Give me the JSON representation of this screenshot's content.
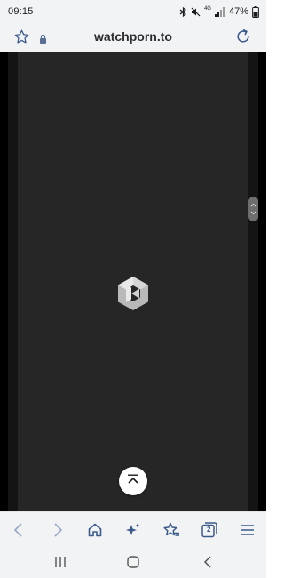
{
  "status_bar": {
    "time": "09:15",
    "network_label": "4G",
    "battery": "47%",
    "icons": [
      "bluetooth-icon",
      "mute-icon",
      "signal-icon",
      "battery-icon"
    ]
  },
  "address_bar": {
    "url": "watchporn.to",
    "icons": [
      "star-icon",
      "lock-icon",
      "reload-icon"
    ]
  },
  "toolbar": {
    "tab_count": "2",
    "icons": [
      "back-icon",
      "forward-icon",
      "home-icon",
      "sparkle-icon",
      "bookmarks-icon",
      "tabs-icon",
      "menu-icon"
    ]
  },
  "navbar": {
    "icons": [
      "recents-icon",
      "home-circle-icon",
      "back-chevron-icon"
    ]
  },
  "colors": {
    "chrome_bg": "#f2f3f5",
    "page_bg": "#262626",
    "icon_blue": "#3a5a8c"
  }
}
